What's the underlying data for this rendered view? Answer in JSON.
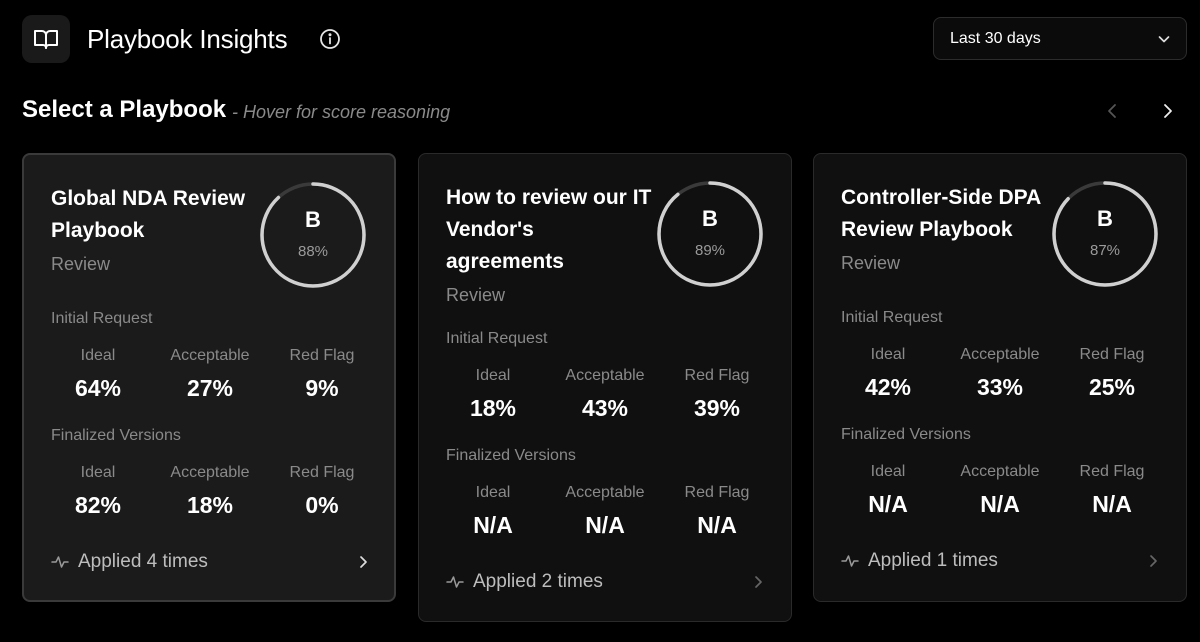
{
  "app": {
    "title": "Playbook Insights",
    "range": "Last 30 days"
  },
  "section": {
    "title": "Select a Playbook",
    "hint": "- Hover for score reasoning"
  },
  "icons": {
    "logo": "open-book-icon",
    "info": "info-circle-icon",
    "range_chevron": "chevron-down-icon",
    "prev": "chevron-left-icon",
    "next": "chevron-right-icon",
    "activity": "activity-pulse-icon",
    "open": "chevron-right-icon"
  },
  "colors": {
    "background": "#000000",
    "card": "#101010",
    "card_active": "#1b1b1b",
    "ring_track": "#3a3a3a",
    "ring_fill": "#d0d0d0",
    "muted_text": "#8a8a8a"
  },
  "cards": [
    {
      "title": "Global NDA Review Playbook",
      "subtitle": "Review",
      "grade": "B",
      "score": "88%",
      "score_value": 0.88,
      "selected": true,
      "initial_label": "Initial Request",
      "initial": [
        {
          "label": "Ideal",
          "value": "64%"
        },
        {
          "label": "Acceptable",
          "value": "27%"
        },
        {
          "label": "Red Flag",
          "value": "9%"
        }
      ],
      "final_label": "Finalized Versions",
      "final": [
        {
          "label": "Ideal",
          "value": "82%"
        },
        {
          "label": "Acceptable",
          "value": "18%"
        },
        {
          "label": "Red Flag",
          "value": "0%"
        }
      ],
      "applied": "Applied 4 times"
    },
    {
      "title": "How to review our IT Vendor's agreements",
      "subtitle": "Review",
      "grade": "B",
      "score": "89%",
      "score_value": 0.89,
      "selected": false,
      "initial_label": "Initial Request",
      "initial": [
        {
          "label": "Ideal",
          "value": "18%"
        },
        {
          "label": "Acceptable",
          "value": "43%"
        },
        {
          "label": "Red Flag",
          "value": "39%"
        }
      ],
      "final_label": "Finalized Versions",
      "final": [
        {
          "label": "Ideal",
          "value": "N/A"
        },
        {
          "label": "Acceptable",
          "value": "N/A"
        },
        {
          "label": "Red Flag",
          "value": "N/A"
        }
      ],
      "applied": "Applied 2 times"
    },
    {
      "title": "Controller-Side DPA Review Playbook",
      "subtitle": "Review",
      "grade": "B",
      "score": "87%",
      "score_value": 0.87,
      "selected": false,
      "initial_label": "Initial Request",
      "initial": [
        {
          "label": "Ideal",
          "value": "42%"
        },
        {
          "label": "Acceptable",
          "value": "33%"
        },
        {
          "label": "Red Flag",
          "value": "25%"
        }
      ],
      "final_label": "Finalized Versions",
      "final": [
        {
          "label": "Ideal",
          "value": "N/A"
        },
        {
          "label": "Acceptable",
          "value": "N/A"
        },
        {
          "label": "Red Flag",
          "value": "N/A"
        }
      ],
      "applied": "Applied 1 times"
    }
  ]
}
